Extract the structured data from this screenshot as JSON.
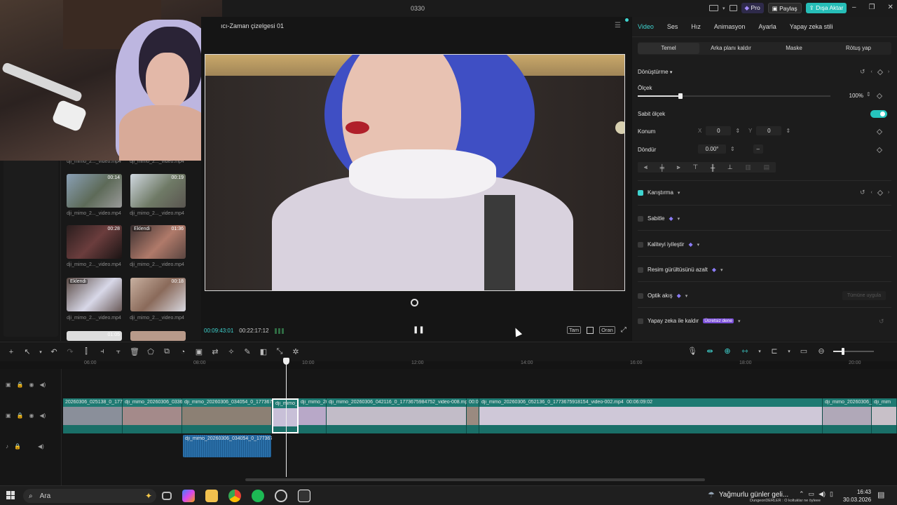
{
  "app": {
    "title": "0330",
    "pro_label": "Pro",
    "share_label": "Paylaş",
    "export_label": "Dışa Aktar",
    "accent": "#3fd4d0"
  },
  "player": {
    "timeline_name": "ıcı-Zaman çizelgesi 01",
    "current_time": "00:09:43:01",
    "total_time": "00:22:17:12",
    "full_label": "Tam",
    "ratio_label": "Oran"
  },
  "media": {
    "items": [
      {
        "label": "dji_mimo_2..._video.mp4",
        "duration": "00:14",
        "badge": ""
      },
      {
        "label": "dji_mimo_2..._video.mp4",
        "duration": "00:19",
        "badge": ""
      },
      {
        "label": "dji_mimo_2..._video.mp4",
        "duration": "00:28",
        "badge": ""
      },
      {
        "label": "dji_mimo_2..._video.mp4",
        "duration": "01:36",
        "badge": "Eklendi"
      },
      {
        "label": "dji_mimo_2..._video.mp4",
        "duration": "",
        "badge": "Eklendi"
      },
      {
        "label": "dji_mimo_2..._video.mp4",
        "duration": "00:18",
        "badge": ""
      },
      {
        "label": "",
        "duration": "01:05",
        "badge": ""
      },
      {
        "label": "",
        "duration": "00:??",
        "badge": ""
      }
    ],
    "top_labels": [
      "dji_mimo_2..._video.mp4",
      "dji_mimo_2..._video.mp4"
    ]
  },
  "inspector": {
    "tabs": [
      "Video",
      "Ses",
      "Hız",
      "Animasyon",
      "Ayarla",
      "Yapay zeka stili"
    ],
    "subtabs": [
      "Temel",
      "Arka planı kaldır",
      "Maske",
      "Rötuş yap"
    ],
    "transform_label": "Dönüştürme",
    "scale_label": "Ölçek",
    "scale_value": "100%",
    "scale_level": 0.22,
    "uniform_scale_label": "Sabit ölçek",
    "position_label": "Konum",
    "x_label": "X",
    "x_value": "0",
    "y_label": "Y",
    "y_value": "0",
    "rotate_label": "Döndür",
    "rotate_value": "0.00°",
    "rotate_dash": "–",
    "blend_label": "Karıştırma",
    "stabilize_label": "Sabitle",
    "enhance_label": "Kaliteyi iyileştir",
    "denoise_label": "Resim gürültüsünü azalt",
    "optical_flow_label": "Optik akış",
    "optical_flow_apply": "Tümüne uygula",
    "ai_remove_label": "Yapay zeka ile kaldır",
    "ai_remove_badge": "Ücretsiz dene"
  },
  "timeline": {
    "ruler_labels": [
      "06:00",
      "08:00",
      "10:00",
      "12:00",
      "14:00",
      "16:00",
      "18:00",
      "20:00"
    ],
    "clips": [
      {
        "name": "20260306_025138_0_1773676"
      },
      {
        "name": "dji_mimo_20260306_0336"
      },
      {
        "name": "dji_mimo_20260306_034054_0_17736761"
      },
      {
        "name": "dji_mimo_20"
      },
      {
        "name": "dji_mimo_20"
      },
      {
        "name": "dji_mimo_20260306_042116_0_1773675984752_video-008.mp4"
      },
      {
        "name": "00:0"
      },
      {
        "name": "dji_mimo_20260306_052136_0_1773675918154_video-002.mp4"
      },
      {
        "name": "00:06:09:02"
      },
      {
        "name": "dji_mimo_20260306_0"
      },
      {
        "name": "dji_mim"
      }
    ],
    "audio_clip_name": "dji_mimo_20260306_034054_0_17736761"
  },
  "taskbar": {
    "search_placeholder": "Ara",
    "weather_text": "Yağmurlu günler geli...",
    "notification_text": "DungeonDERLER : O koltuklar ne öyleee",
    "time": "16:43",
    "date": "30.03.2026"
  }
}
